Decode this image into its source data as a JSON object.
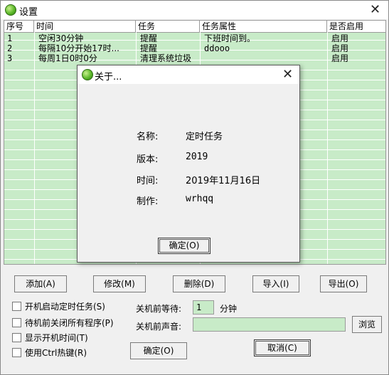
{
  "window": {
    "title": "设置",
    "close_glyph": "✕"
  },
  "table": {
    "headers": [
      "序号",
      "时间",
      "任务",
      "任务属性",
      "是否启用"
    ],
    "rows": [
      [
        "1",
        "空闲30分钟",
        "提醒",
        "下班时间到。",
        "启用"
      ],
      [
        "2",
        "每隔10分开始17时...",
        "提醒",
        "ddooo",
        "启用"
      ],
      [
        "3",
        "每周1日0时0分",
        "清理系统垃圾",
        "",
        "启用"
      ]
    ]
  },
  "buttons": {
    "add": "添加(A)",
    "edit": "修改(M)",
    "delete": "删除(D)",
    "import": "导入(I)",
    "export": "导出(O)",
    "browse": "浏览",
    "ok": "确定(O)",
    "cancel": "取消(C)"
  },
  "options": {
    "startup_tasks": "开机启动定时任务(S)",
    "close_programs": "待机前关闭所有程序(P)",
    "show_boot_time": "显示开机时间(T)",
    "ctrl_hotkey": "使用Ctrl热键(R)"
  },
  "shutdown": {
    "wait_label": "关机前等待:",
    "wait_value": "1",
    "wait_unit": "分钟",
    "sound_label": "关机前声音:",
    "sound_value": ""
  },
  "about": {
    "title": "关于...",
    "close_glyph": "✕",
    "name_label": "名称:",
    "name_value": "定时任务",
    "version_label": "版本:",
    "version_value": "2019",
    "date_label": "时间:",
    "date_value": "2019年11月16日",
    "author_label": "制作:",
    "author_value": "wrhqq",
    "ok": "确定(O)"
  },
  "colors": {
    "grid_bg": "#c8ebc8",
    "field_bg": "#c8ebc8"
  }
}
